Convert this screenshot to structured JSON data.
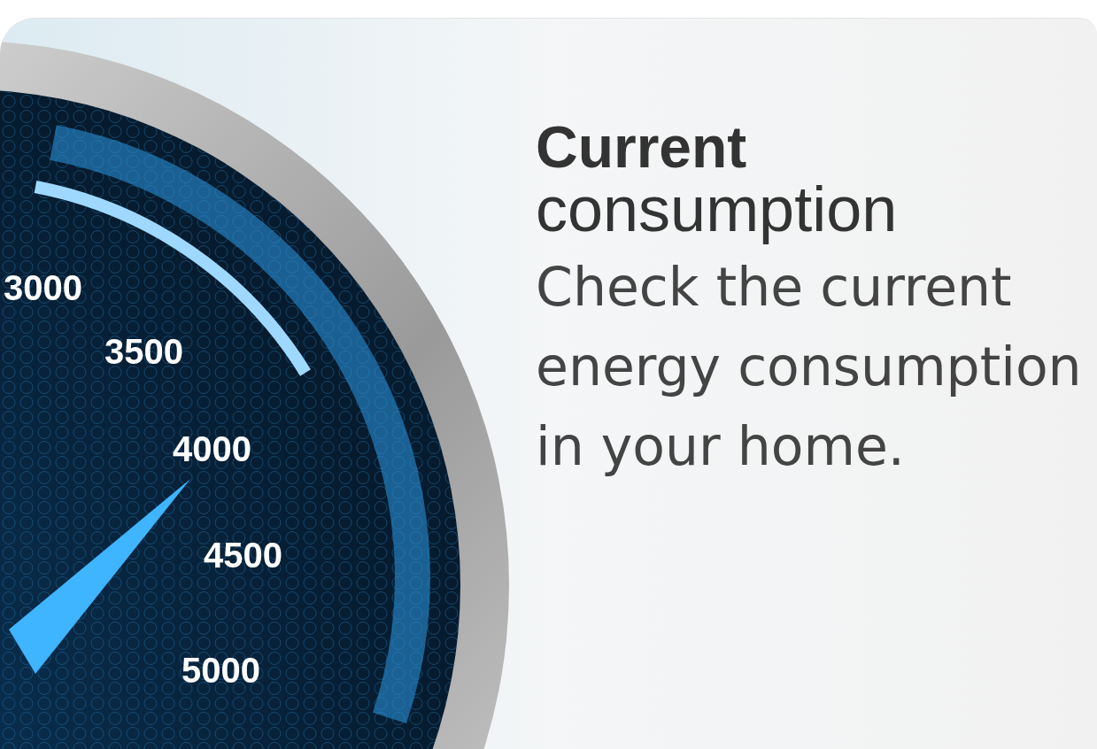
{
  "gauge": {
    "labels": [
      "3000",
      "3500",
      "4000",
      "4500",
      "5000"
    ]
  },
  "title": {
    "bold": "Current",
    "light": "consumption"
  },
  "description": "Check the current energy consumption in your home."
}
